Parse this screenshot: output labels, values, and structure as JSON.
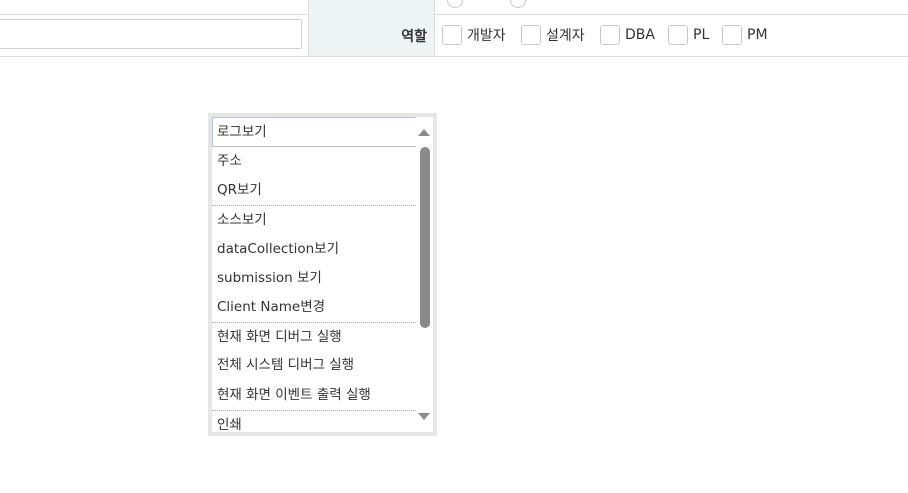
{
  "form": {
    "role_label": "역할",
    "role_options": [
      {
        "label": "개발자",
        "checked": false
      },
      {
        "label": "설계자",
        "checked": false
      },
      {
        "label": "DBA",
        "checked": false
      },
      {
        "label": "PL",
        "checked": false
      },
      {
        "label": "PM",
        "checked": false
      }
    ],
    "text_input_value": ""
  },
  "context_menu": {
    "items": [
      {
        "label": "로그보기"
      },
      {
        "label": "주소"
      },
      {
        "label": "QR보기"
      },
      {
        "label": "소스보기"
      },
      {
        "label": "dataCollection보기"
      },
      {
        "label": "submission 보기"
      },
      {
        "label": "Client Name변경"
      },
      {
        "label": "현재 화면 디버그 실행"
      },
      {
        "label": "전체 시스템 디버그 실행"
      },
      {
        "label": "현재 화면 이벤트 출력 실행"
      },
      {
        "label": "인쇄"
      }
    ]
  }
}
